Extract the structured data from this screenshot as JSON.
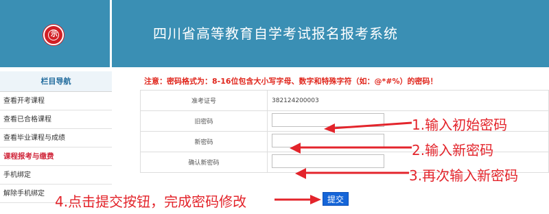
{
  "header": {
    "title": "四川省高等教育自学考试报名报考系统",
    "logo_text": "示"
  },
  "sidebar": {
    "heading": "栏目导航",
    "items": [
      {
        "label": "查看开考课程"
      },
      {
        "label": "查看已合格课程"
      },
      {
        "label": "查看毕业课程与成绩"
      }
    ],
    "section": "课程报考与缴费",
    "items2": [
      {
        "label": "手机绑定"
      },
      {
        "label": "解除手机绑定"
      }
    ]
  },
  "main": {
    "notice": "注意：密码格式为：8-16位包含大小写字母、数字和特殊字符（如：@*#%）的密码！",
    "form": {
      "rows": [
        {
          "label": "准考证号",
          "value": "382124200003"
        },
        {
          "label": "旧密码",
          "value": ""
        },
        {
          "label": "新密码",
          "value": ""
        },
        {
          "label": "确认新密码",
          "value": ""
        }
      ],
      "submit_label": "提交"
    }
  },
  "annotations": {
    "step1": "1.输入初始密码",
    "step2": "2.输入新密码",
    "step3": "3.再次输入新密码",
    "step4": "4.点击提交按钮，完成密码修改"
  },
  "colors": {
    "header_bg": "#3a8fb4",
    "annotation": "#e3242b",
    "notice": "#e0261c",
    "section": "#d0263a",
    "button": "#1565d8"
  }
}
